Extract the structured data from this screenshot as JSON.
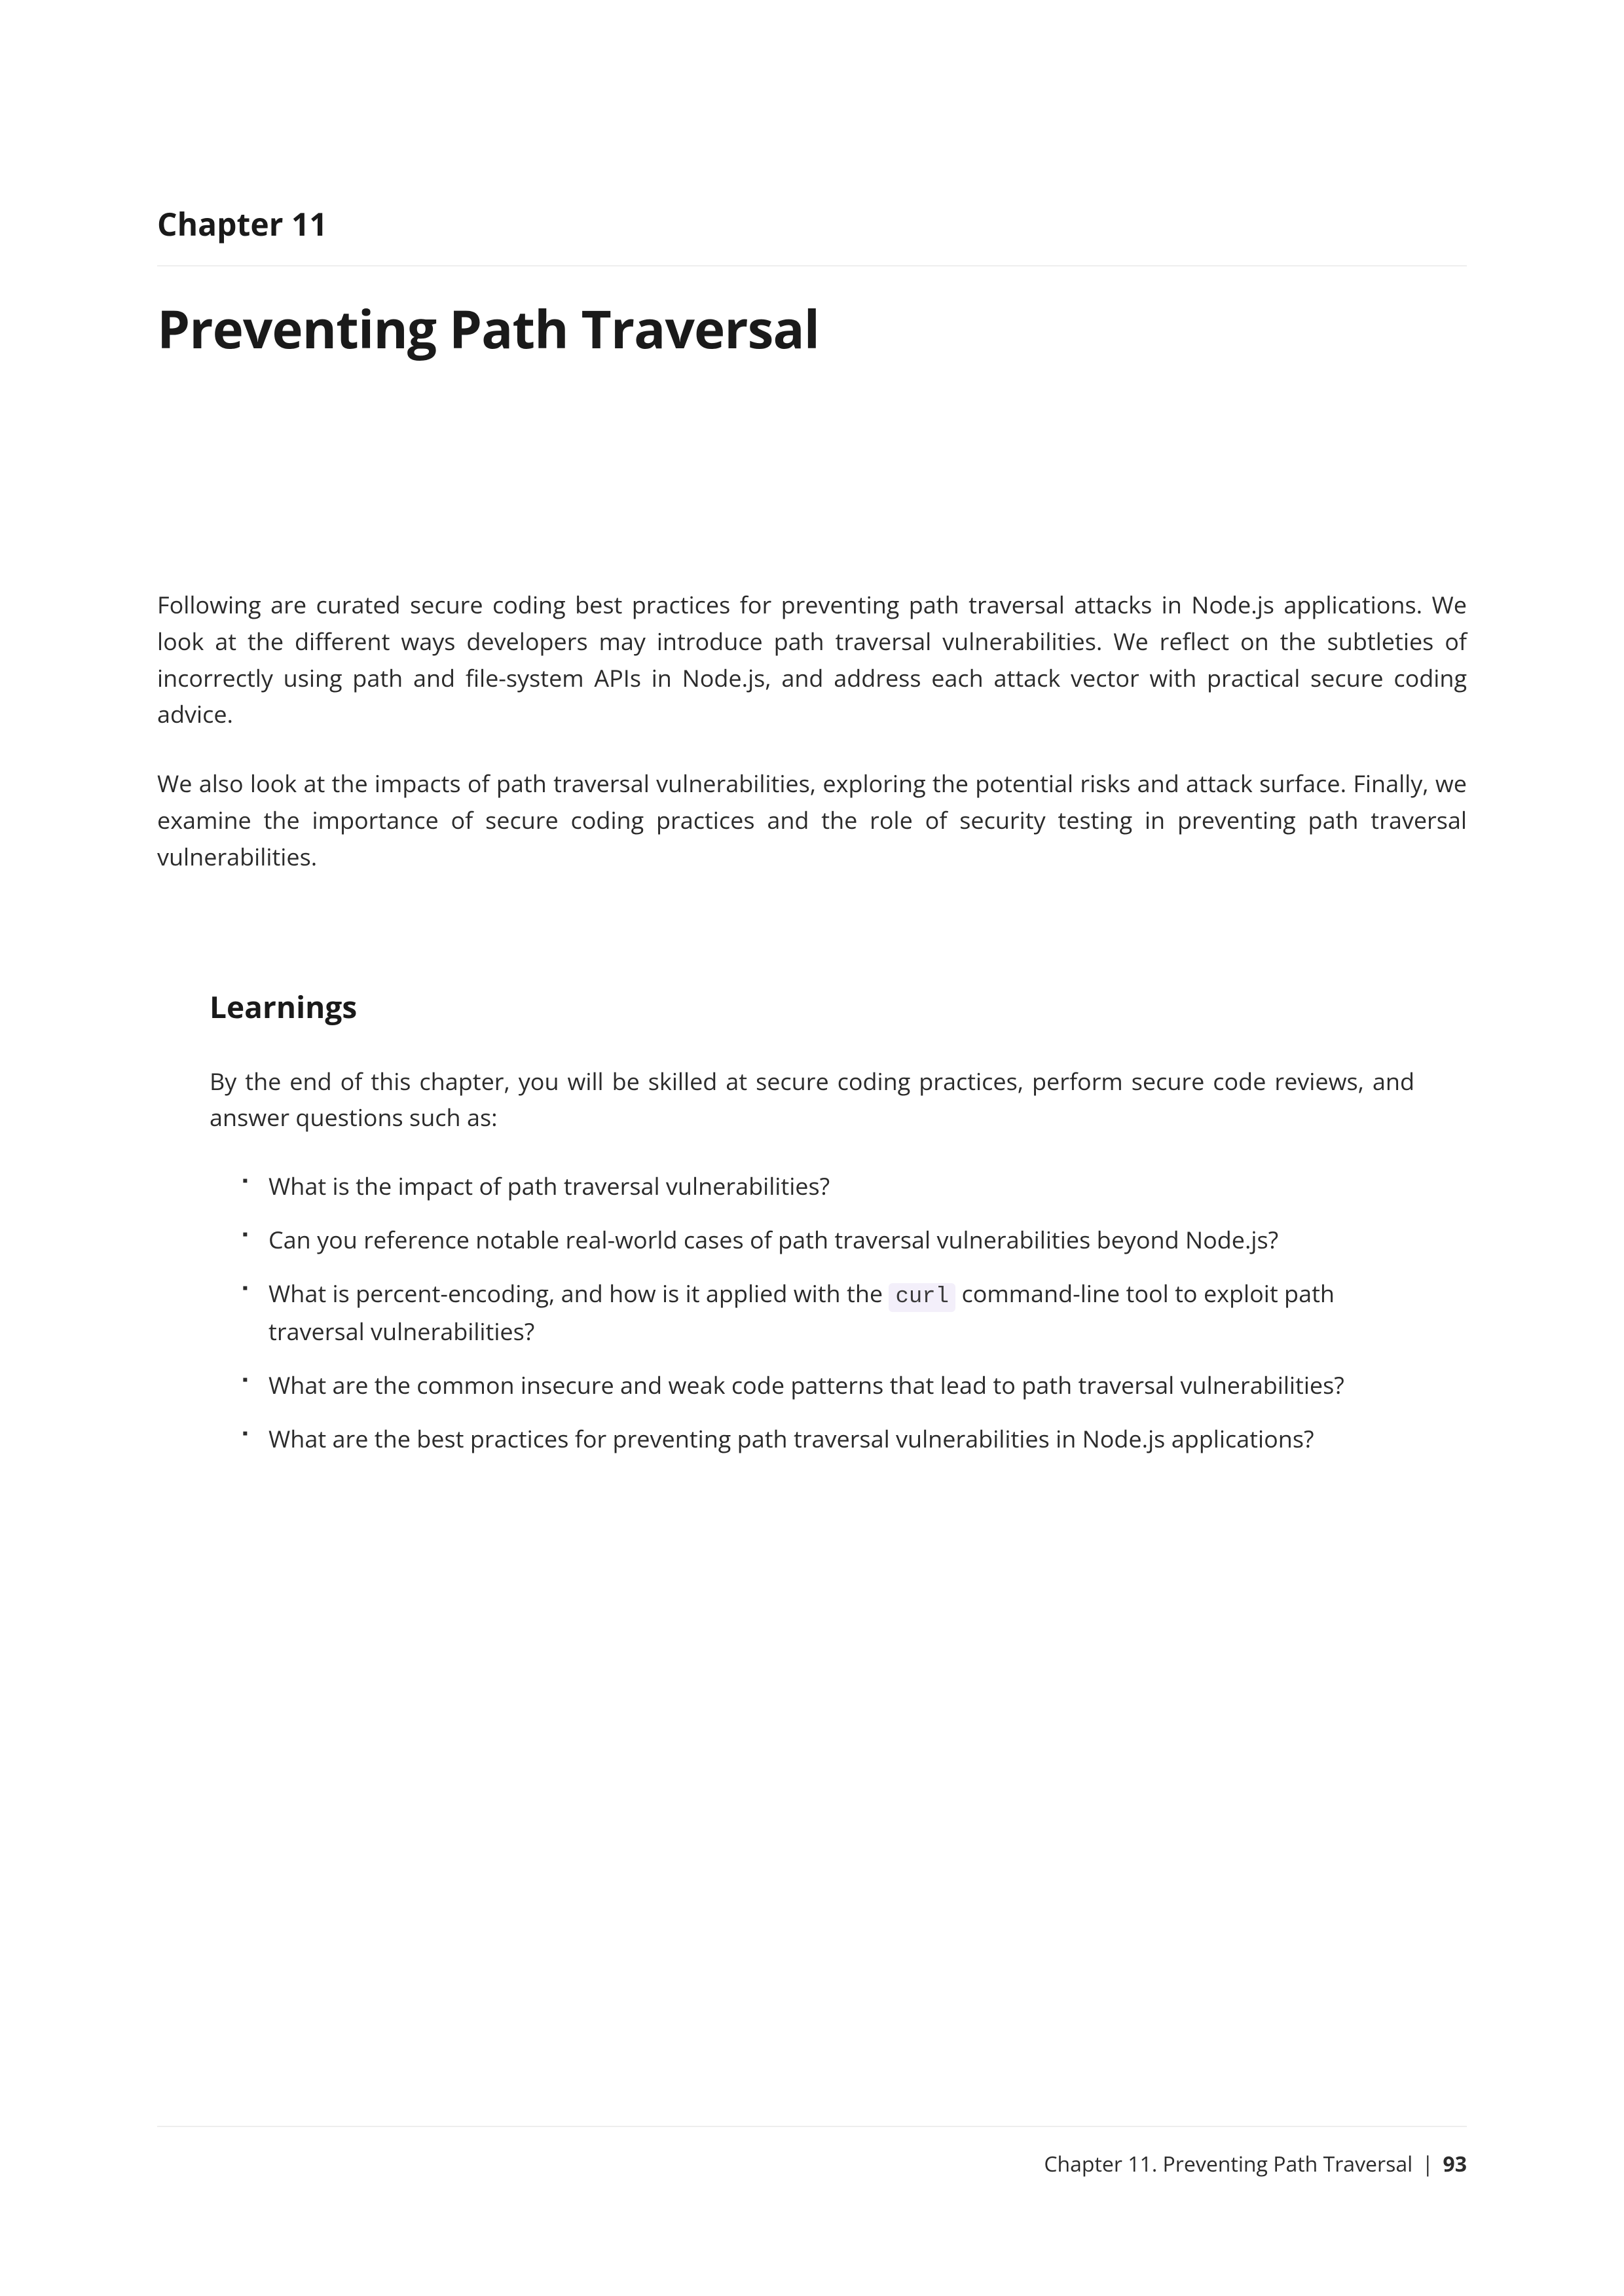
{
  "chapter": {
    "label": "Chapter 11",
    "title": "Preventing Path Traversal"
  },
  "intro": {
    "p1": "Following are curated secure coding best practices for preventing path traversal attacks in Node.js applications. We look at the different ways developers may introduce path traversal vulnerabilities. We reflect on the subtleties of incorrectly using path and file-system APIs in Node.js, and address each attack vector with practical secure coding advice.",
    "p2": "We also look at the impacts of path traversal vulnerabilities, exploring the potential risks and attack surface. Finally, we examine the importance of secure coding practices and the role of security testing in preventing path traversal vulnerabilities."
  },
  "learnings": {
    "title": "Learnings",
    "intro": "By the end of this chapter, you will be skilled at secure coding practices, perform secure code reviews, and answer questions such as:",
    "items": {
      "0": "What is the impact of path traversal vulnerabilities?",
      "1": "Can you reference notable real-world cases of path traversal vulnerabilities beyond Node.js?",
      "2_pre": "What is percent-encoding, and how is it applied with the ",
      "2_code": "curl",
      "2_post": " command-line tool to exploit path traversal vulnerabilities?",
      "3": "What are the common insecure and weak code patterns that lead to path traversal vulnerabilities?",
      "4": "What are the best practices for preventing path traversal vulnerabilities in Node.js applications?"
    }
  },
  "footer": {
    "chapter_ref": "Chapter 11. Preventing Path Traversal",
    "separator": "|",
    "page_number": "93"
  }
}
